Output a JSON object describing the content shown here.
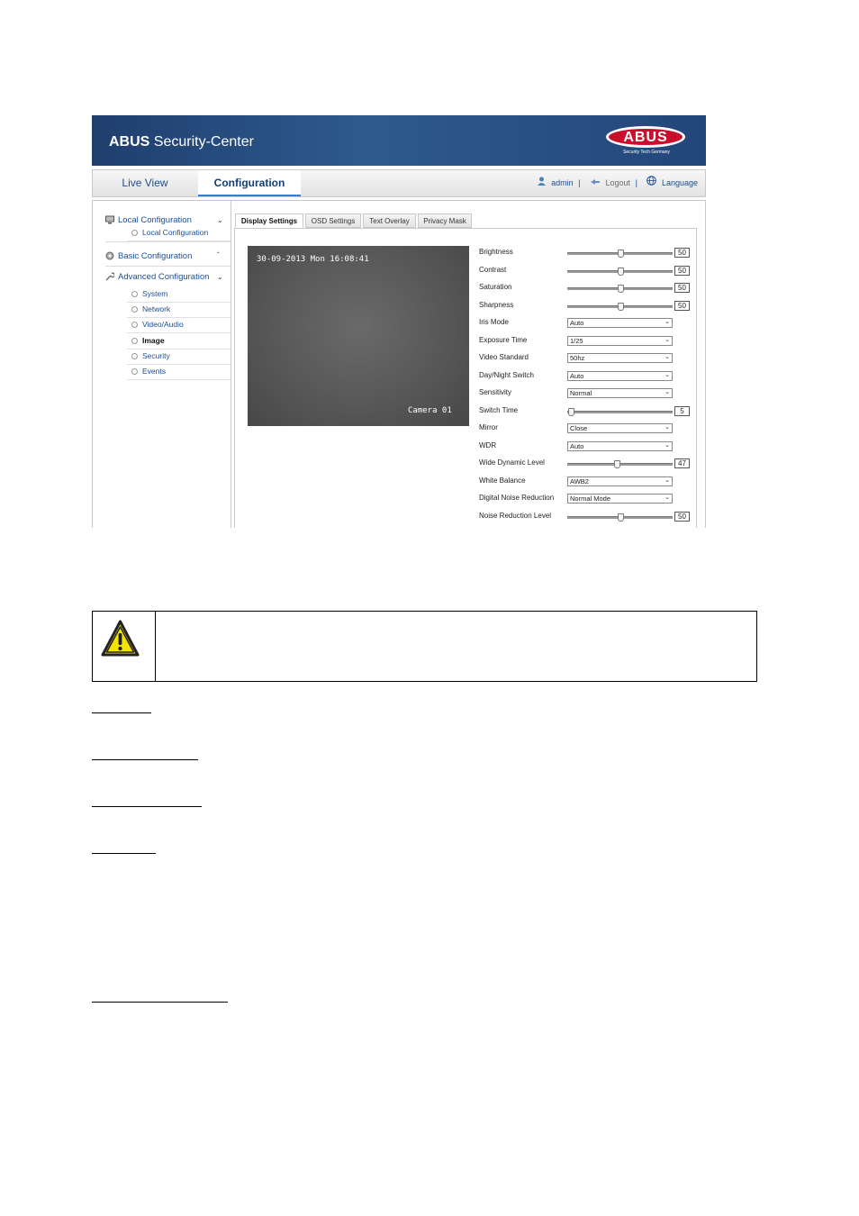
{
  "banner": {
    "title_bold": "ABUS",
    "title_rest": " Security-Center",
    "logo_text": "ABUS",
    "logo_sub": "Security Tech Germany"
  },
  "nav": {
    "tabs": [
      {
        "label": "Live View"
      },
      {
        "label": "Configuration"
      }
    ],
    "user": "admin",
    "logout": "Logout",
    "language": "Language"
  },
  "sidebar": {
    "local": {
      "label": "Local Configuration",
      "items": [
        "Local Configuration"
      ]
    },
    "basic": {
      "label": "Basic Configuration"
    },
    "advanced": {
      "label": "Advanced Configuration",
      "items": [
        "System",
        "Network",
        "Video/Audio",
        "Image",
        "Security",
        "Events"
      ]
    }
  },
  "tabs": [
    "Display Settings",
    "OSD Settings",
    "Text Overlay",
    "Privacy Mask"
  ],
  "preview": {
    "date": "30-09-2013 Mon 16:08:41",
    "name": "Camera 01"
  },
  "settings": {
    "brightness": {
      "label": "Brightness",
      "value": "50",
      "level": 0.5
    },
    "contrast": {
      "label": "Contrast",
      "value": "50",
      "level": 0.5
    },
    "saturation": {
      "label": "Saturation",
      "value": "50",
      "level": 0.5
    },
    "sharpness": {
      "label": "Sharpness",
      "value": "50",
      "level": 0.5
    },
    "iris_mode": {
      "label": "Iris Mode",
      "value": "Auto"
    },
    "exposure_time": {
      "label": "Exposure Time",
      "value": "1/25"
    },
    "video_standard": {
      "label": "Video Standard",
      "value": "50hz"
    },
    "day_night": {
      "label": "Day/Night Switch",
      "value": "Auto"
    },
    "sensitivity": {
      "label": "Sensitivity",
      "value": "Normal"
    },
    "switch_time": {
      "label": "Switch Time",
      "value": "5",
      "level": 0.03
    },
    "mirror": {
      "label": "Mirror",
      "value": "Close"
    },
    "wdr": {
      "label": "WDR",
      "value": "Auto"
    },
    "wide_dynamic_level": {
      "label": "Wide Dynamic Level",
      "value": "47",
      "level": 0.47
    },
    "white_balance": {
      "label": "White Balance",
      "value": "AWB2"
    },
    "dnr": {
      "label": "Digital Noise Reduction",
      "value": "Normal Mode"
    },
    "noise_level": {
      "label": "Noise Reduction Level",
      "value": "50",
      "level": 0.5
    }
  },
  "colors": {
    "banner": "#2e5a8f",
    "accent": "#1a4f94",
    "logo_red": "#c8102e"
  }
}
